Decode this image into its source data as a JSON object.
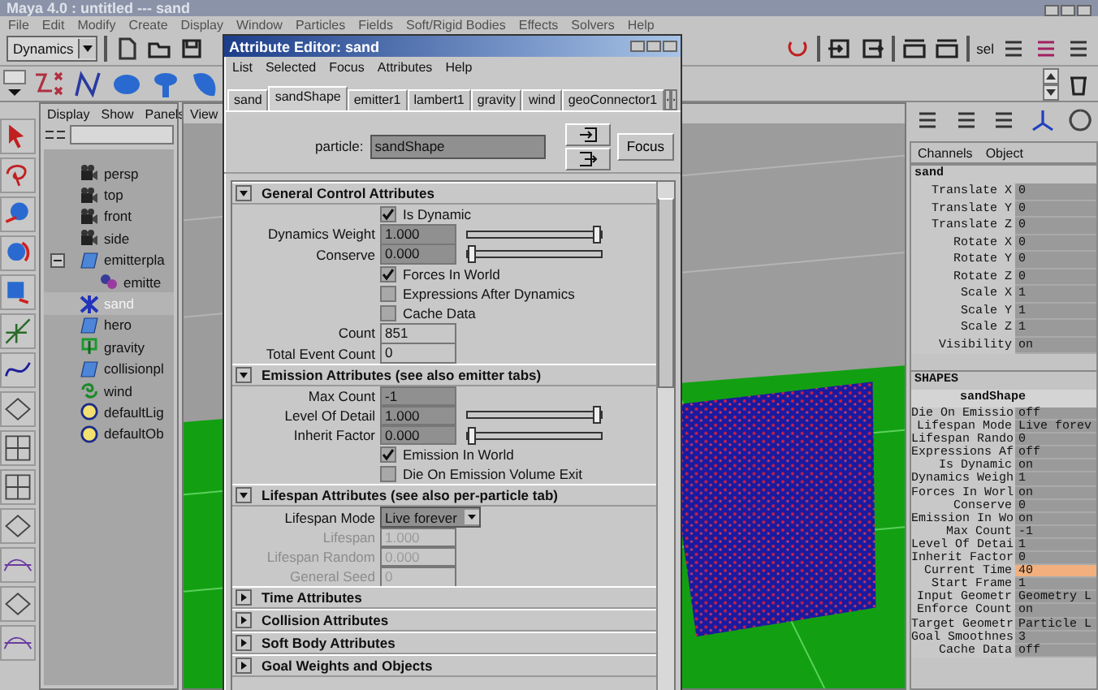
{
  "app": {
    "title": "Maya 4.0 : untitled  ---  sand"
  },
  "menu_bar": [
    "File",
    "Edit",
    "Modify",
    "Create",
    "Display",
    "Window",
    "Particles",
    "Fields",
    "Soft/Rigid Bodies",
    "Effects",
    "Solvers",
    "Help"
  ],
  "toolbar": {
    "mode": "Dynamics",
    "selection_label": "sel"
  },
  "outliner": {
    "menu": [
      "Display",
      "Show",
      "Panels"
    ],
    "items": [
      {
        "label": "persp",
        "kind": "camera",
        "selected": false
      },
      {
        "label": "top",
        "kind": "camera",
        "selected": false
      },
      {
        "label": "front",
        "kind": "camera",
        "selected": false
      },
      {
        "label": "side",
        "kind": "camera",
        "selected": false
      },
      {
        "label": "emitterpla",
        "kind": "plane",
        "selected": false,
        "expanded": true,
        "children": [
          {
            "label": "emitte",
            "kind": "emitter",
            "selected": false
          }
        ]
      },
      {
        "label": "sand",
        "kind": "particle",
        "selected": true
      },
      {
        "label": "hero",
        "kind": "plane",
        "selected": false
      },
      {
        "label": "gravity",
        "kind": "gravity",
        "selected": false
      },
      {
        "label": "collisionpl",
        "kind": "plane",
        "selected": false
      },
      {
        "label": "wind",
        "kind": "wind",
        "selected": false
      },
      {
        "label": "defaultLig",
        "kind": "set",
        "selected": false
      },
      {
        "label": "defaultOb",
        "kind": "set",
        "selected": false
      }
    ]
  },
  "viewport": {
    "menu": [
      "View"
    ]
  },
  "attribute_editor": {
    "title": "Attribute Editor: sand",
    "menu": [
      "List",
      "Selected",
      "Focus",
      "Attributes",
      "Help"
    ],
    "tabs": [
      {
        "label": "sand",
        "selected": false
      },
      {
        "label": "sandShape",
        "selected": true
      },
      {
        "label": "emitter1",
        "selected": false
      },
      {
        "label": "lambert1",
        "selected": false
      },
      {
        "label": "gravity",
        "selected": false
      },
      {
        "label": "wind",
        "selected": false
      },
      {
        "label": "geoConnector1",
        "selected": false
      }
    ],
    "particle": {
      "label": "particle:",
      "value": "sandShape"
    },
    "focus_button": "Focus",
    "sections": [
      {
        "title": "General Control Attributes",
        "expanded": true,
        "rows": [
          {
            "kind": "checkbox",
            "label": "Is Dynamic",
            "checked": true
          },
          {
            "kind": "slider",
            "label": "Dynamics Weight",
            "value": "1.000",
            "level": 1
          },
          {
            "kind": "slider",
            "label": "Conserve",
            "value": "0.000",
            "level": 0
          },
          {
            "kind": "checkbox",
            "label": "Forces In World",
            "checked": true
          },
          {
            "kind": "checkbox",
            "label": "Expressions After Dynamics",
            "checked": false
          },
          {
            "kind": "checkbox",
            "label": "Cache Data",
            "checked": false
          },
          {
            "kind": "field",
            "label": "Count",
            "value": "851",
            "read_only": true,
            "disabled": false
          },
          {
            "kind": "field",
            "label": "Total Event Count",
            "value": "0",
            "read_only": true,
            "disabled": false
          }
        ]
      },
      {
        "title": "Emission Attributes (see also emitter tabs)",
        "expanded": true,
        "rows": [
          {
            "kind": "field",
            "label": "Max Count",
            "value": "-1",
            "read_only": false,
            "disabled": false
          },
          {
            "kind": "slider",
            "label": "Level Of Detail",
            "value": "1.000",
            "level": 1
          },
          {
            "kind": "slider",
            "label": "Inherit Factor",
            "value": "0.000",
            "level": 0
          },
          {
            "kind": "checkbox",
            "label": "Emission In World",
            "checked": true
          },
          {
            "kind": "checkbox",
            "label": "Die On Emission Volume Exit",
            "checked": false
          }
        ]
      },
      {
        "title": "Lifespan Attributes (see also per-particle tab)",
        "expanded": true,
        "rows": [
          {
            "kind": "dropdown",
            "label": "Lifespan Mode",
            "value": "Live forever"
          },
          {
            "kind": "field",
            "label": "Lifespan",
            "value": "1.000",
            "read_only": true,
            "disabled": true
          },
          {
            "kind": "field",
            "label": "Lifespan Random",
            "value": "0.000",
            "read_only": true,
            "disabled": true
          },
          {
            "kind": "field",
            "label": "General Seed",
            "value": "0",
            "read_only": true,
            "disabled": true
          }
        ]
      },
      {
        "title": "Time Attributes",
        "expanded": false
      },
      {
        "title": "Collision Attributes",
        "expanded": false
      },
      {
        "title": "Soft Body Attributes",
        "expanded": false
      },
      {
        "title": "Goal Weights and Objects",
        "expanded": false
      }
    ]
  },
  "channel_box": {
    "menu": [
      "Channels",
      "Object"
    ],
    "node": "sand",
    "node_attributes": [
      {
        "name": "Translate X",
        "value": "0"
      },
      {
        "name": "Translate Y",
        "value": "0"
      },
      {
        "name": "Translate Z",
        "value": "0"
      },
      {
        "name": "Rotate X",
        "value": "0"
      },
      {
        "name": "Rotate Y",
        "value": "0"
      },
      {
        "name": "Rotate Z",
        "value": "0"
      },
      {
        "name": "Scale X",
        "value": "1"
      },
      {
        "name": "Scale Y",
        "value": "1"
      },
      {
        "name": "Scale Z",
        "value": "1"
      },
      {
        "name": "Visibility",
        "value": "on"
      }
    ],
    "shapes_heading": "SHAPES",
    "shape": "sandShape",
    "shape_attributes": [
      {
        "name": "Die On Emissio",
        "value": "off",
        "selected": false
      },
      {
        "name": "Lifespan Mode",
        "value": "Live forev",
        "selected": false
      },
      {
        "name": "Lifespan Rando",
        "value": "0",
        "selected": false
      },
      {
        "name": "Expressions Af",
        "value": "off",
        "selected": false
      },
      {
        "name": "Is Dynamic",
        "value": "on",
        "selected": false
      },
      {
        "name": "Dynamics Weigh",
        "value": "1",
        "selected": false
      },
      {
        "name": "Forces In Worl",
        "value": "on",
        "selected": false
      },
      {
        "name": "Conserve",
        "value": "0",
        "selected": false
      },
      {
        "name": "Emission In Wo",
        "value": "on",
        "selected": false
      },
      {
        "name": "Max Count",
        "value": "-1",
        "selected": false
      },
      {
        "name": "Level Of Detai",
        "value": "1",
        "selected": false
      },
      {
        "name": "Inherit Factor",
        "value": "0",
        "selected": false
      },
      {
        "name": "Current Time",
        "value": "40",
        "selected": true
      },
      {
        "name": "Start Frame",
        "value": "1",
        "selected": false
      },
      {
        "name": "Input Geometr",
        "value": "Geometry L",
        "selected": false
      },
      {
        "name": "Enforce Count",
        "value": "on",
        "selected": false
      },
      {
        "name": "Target Geometr",
        "value": "Particle L",
        "selected": false
      },
      {
        "name": "Goal Smoothnes",
        "value": "3",
        "selected": false
      },
      {
        "name": "Cache Data",
        "value": "off",
        "selected": false
      }
    ]
  }
}
